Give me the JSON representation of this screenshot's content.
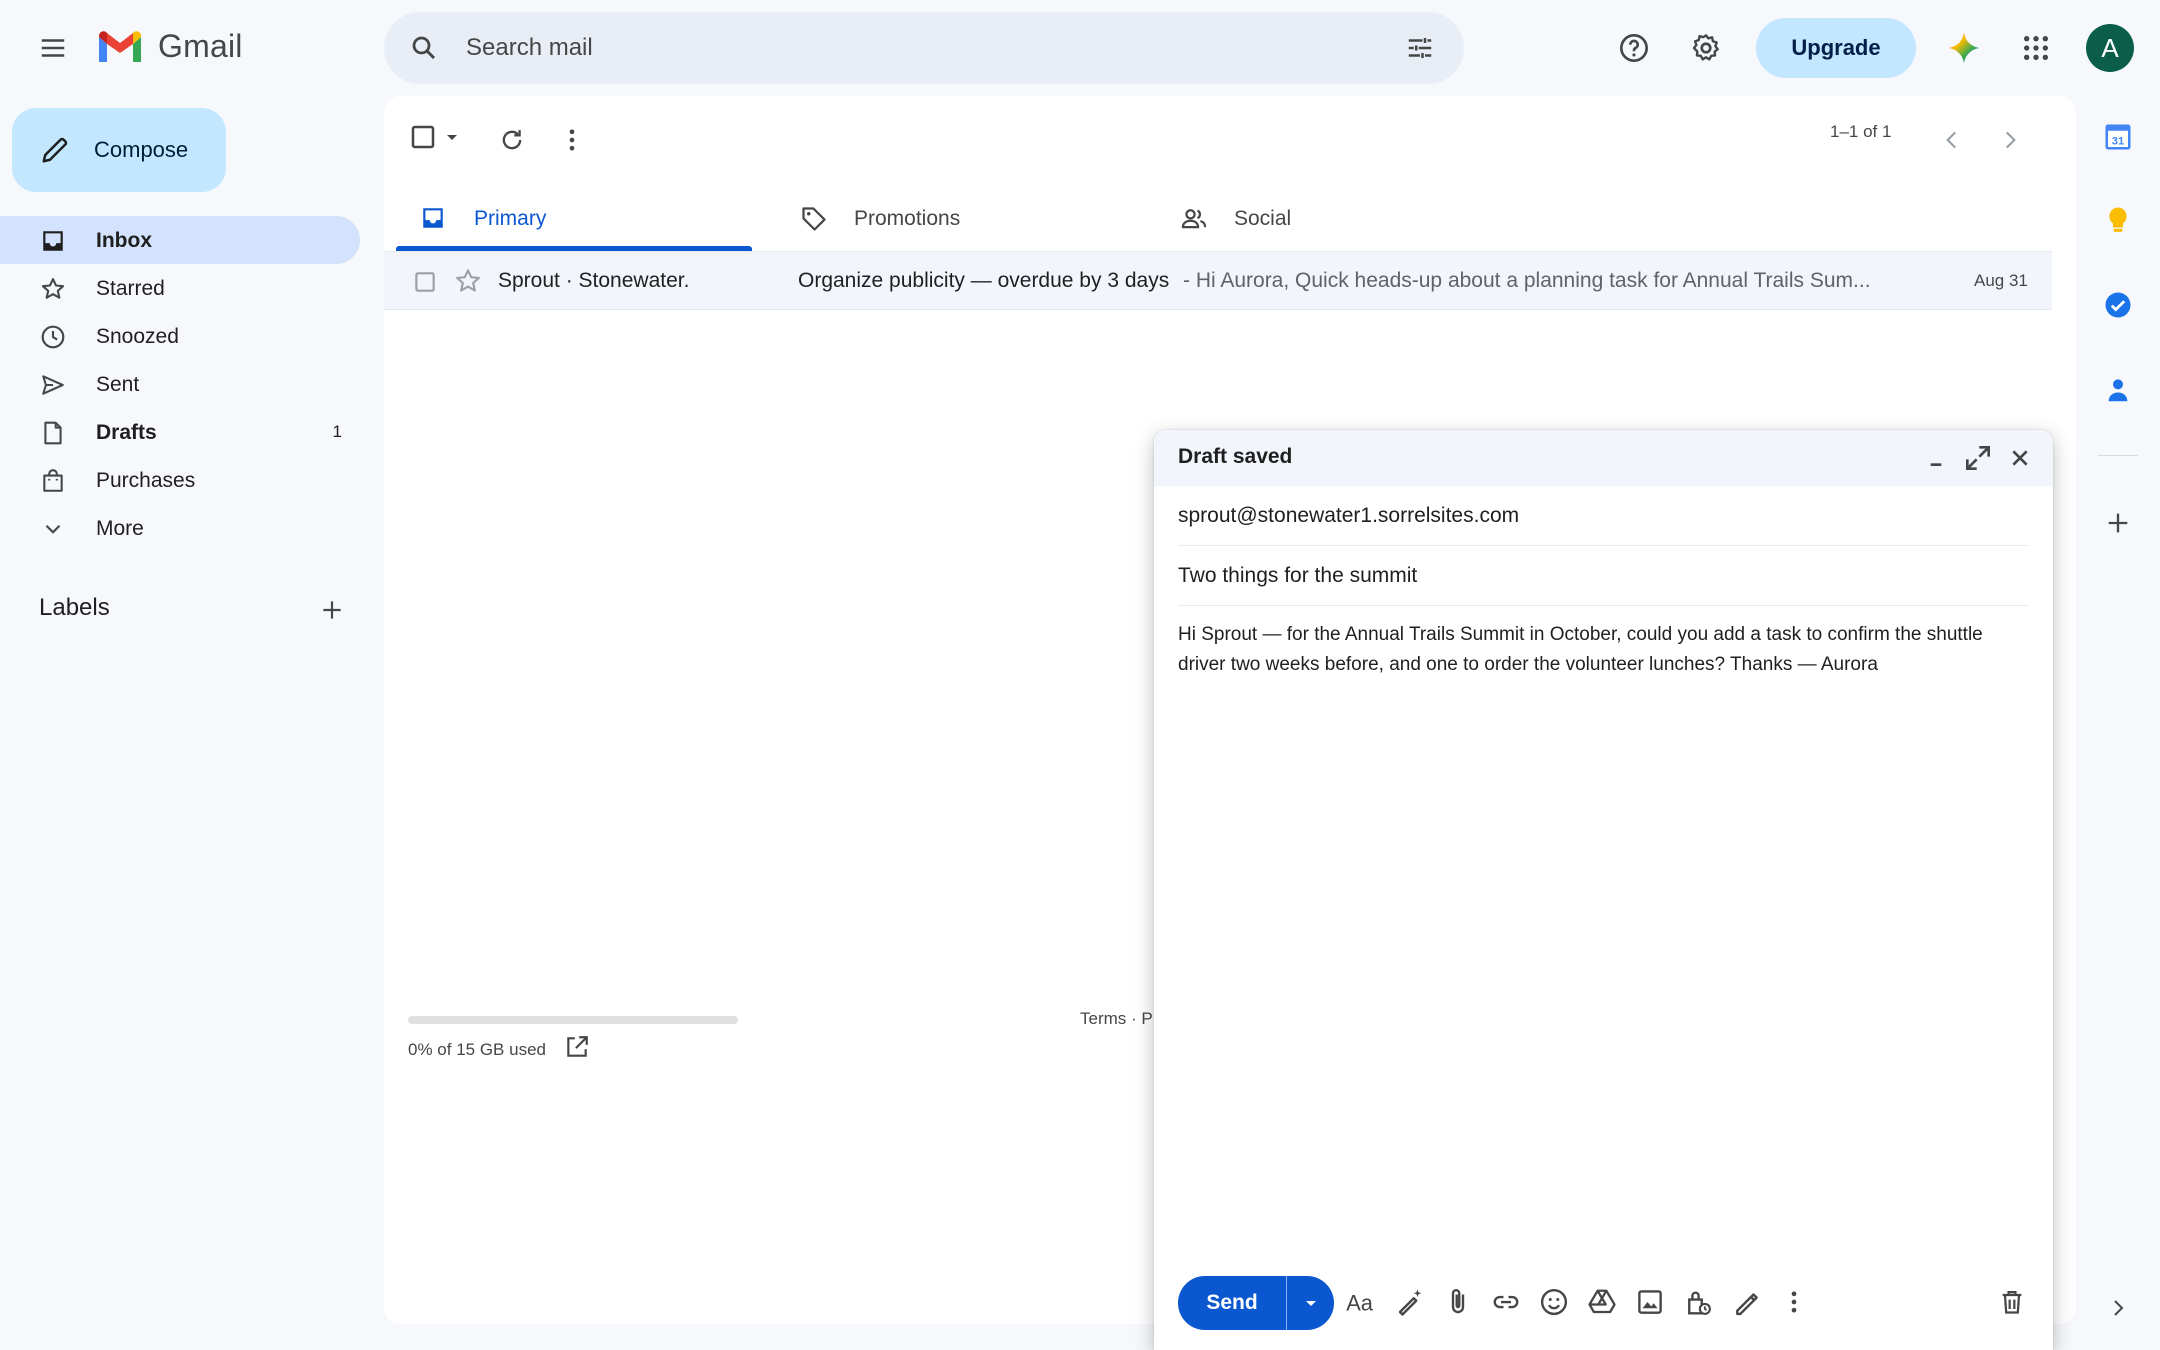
{
  "app": {
    "name": "Gmail"
  },
  "search": {
    "placeholder": "Search mail"
  },
  "header": {
    "upgrade_label": "Upgrade",
    "avatar_letter": "A"
  },
  "compose_button": {
    "label": "Compose"
  },
  "sidebar": {
    "items": [
      {
        "label": "Inbox",
        "count": ""
      },
      {
        "label": "Starred",
        "count": ""
      },
      {
        "label": "Snoozed",
        "count": ""
      },
      {
        "label": "Sent",
        "count": ""
      },
      {
        "label": "Drafts",
        "count": "1"
      },
      {
        "label": "Purchases",
        "count": ""
      },
      {
        "label": "More",
        "count": ""
      }
    ],
    "labels_title": "Labels"
  },
  "toolbar": {
    "range_text": "1–1 of 1"
  },
  "tabs": [
    {
      "label": "Primary",
      "icon": "inbox-icon"
    },
    {
      "label": "Promotions",
      "icon": "tag-icon"
    },
    {
      "label": "Social",
      "icon": "people-icon"
    }
  ],
  "emails": [
    {
      "sender": "Sprout · Stonewater.",
      "subject": "Organize publicity — overdue by 3 days",
      "snippet": " - Hi Aurora, Quick heads-up about a planning task for Annual Trails Sum...",
      "date": "Aug 31",
      "starred": false
    }
  ],
  "storage": {
    "text": "0% of 15 GB used",
    "fraction_used": 0.0
  },
  "footer": {
    "terms": "Terms · P"
  },
  "side_panel": {
    "calendar_day": "31"
  },
  "compose": {
    "title": "Draft saved",
    "to": "sprout@stonewater1.sorrelsites.com",
    "subject": "Two things for the summit",
    "body": "Hi Sprout — for the Annual Trails Summit in October, could you add a task to confirm the shuttle driver two weeks before, and one to order the volunteer lunches? Thanks — Aurora",
    "send_label": "Send",
    "minimize_label": "_"
  },
  "colors": {
    "accent": "#0b57d0",
    "compose_bg": "#c2e7ff",
    "active_nav": "#d3e3fd",
    "page_bg": "#f6f8fc"
  }
}
